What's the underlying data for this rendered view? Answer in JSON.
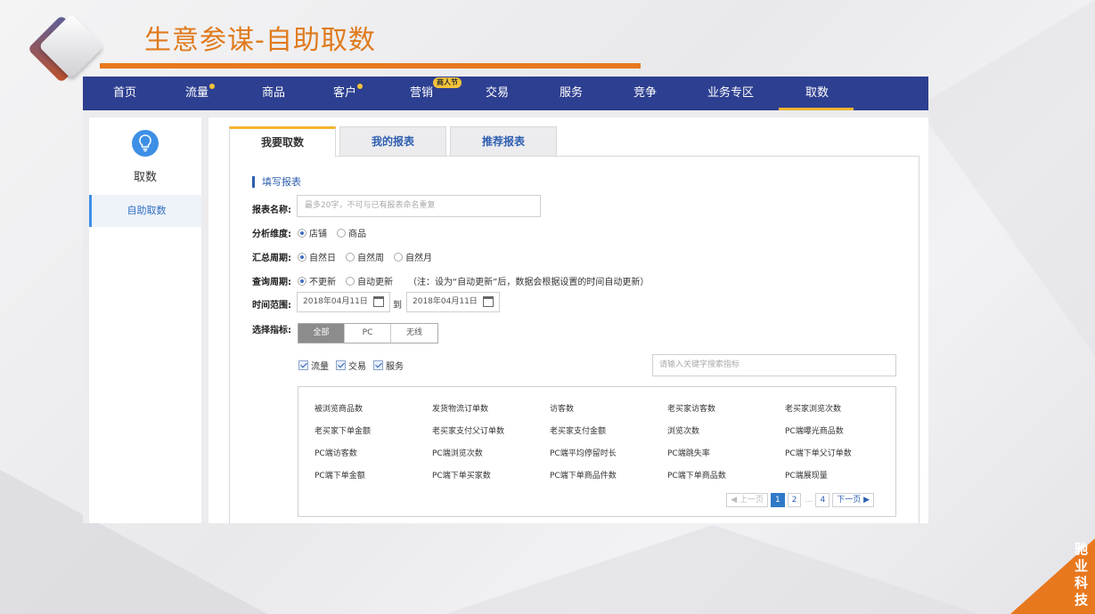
{
  "slide": {
    "title": "生意参谋-自助取数",
    "brand_line1": "驰 业",
    "brand_line2": "科 技"
  },
  "nav": {
    "items": [
      {
        "label": "首页"
      },
      {
        "label": "流量"
      },
      {
        "label": "商品"
      },
      {
        "label": "客户"
      },
      {
        "label": "营销",
        "badge": "商人节"
      },
      {
        "label": "交易"
      },
      {
        "label": "服务"
      },
      {
        "label": "竞争"
      },
      {
        "label": "业务专区"
      },
      {
        "label": "取数"
      }
    ]
  },
  "sidebar": {
    "title": "取数",
    "items": [
      {
        "label": "自助取数"
      }
    ]
  },
  "tabs": [
    {
      "label": "我要取数"
    },
    {
      "label": "我的报表"
    },
    {
      "label": "推荐报表"
    }
  ],
  "form": {
    "section_title": "填写报表",
    "name_label": "报表名称:",
    "name_placeholder": "最多20字，不可与已有报表命名重复",
    "dimension_label": "分析维度:",
    "dimension_options": [
      "店铺",
      "商品"
    ],
    "summary_label": "汇总周期:",
    "summary_options": [
      "自然日",
      "自然周",
      "自然月"
    ],
    "query_label": "查询周期:",
    "query_options": [
      "不更新",
      "自动更新"
    ],
    "query_note": "（注：设为“自动更新”后，数据会根据设置的时间自动更新）",
    "range_label": "时间范围:",
    "date_start": "2018年04月11日",
    "date_to": "到",
    "date_end": "2018年04月11日",
    "metric_label": "选择指标:",
    "segments": [
      "全部",
      "PC",
      "无线"
    ],
    "checkboxes": [
      "流量",
      "交易",
      "服务"
    ],
    "search_placeholder": "请输入关键字搜索指标"
  },
  "metrics": [
    [
      "被浏览商品数",
      "发货物流订单数",
      "访客数",
      "老买家访客数",
      "老买家浏览次数"
    ],
    [
      "老买家下单金额",
      "老买家支付父订单数",
      "老买家支付金额",
      "浏览次数",
      "PC端曝光商品数"
    ],
    [
      "PC端访客数",
      "PC端浏览次数",
      "PC端平均停留时长",
      "PC端跳失率",
      "PC端下单父订单数"
    ],
    [
      "PC端下单金额",
      "PC端下单买家数",
      "PC端下单商品件数",
      "PC端下单商品数",
      "PC端展现量"
    ]
  ],
  "pager": {
    "prev": "◀ 上一页",
    "pages": [
      "1",
      "2"
    ],
    "dots": "…",
    "last": "4",
    "next": "下一页 ▶"
  },
  "colors": {
    "accent_orange": "#e8781e",
    "nav_blue": "#2d3f90",
    "tab_gold": "#f3b530",
    "link_blue": "#2f5fb0"
  }
}
